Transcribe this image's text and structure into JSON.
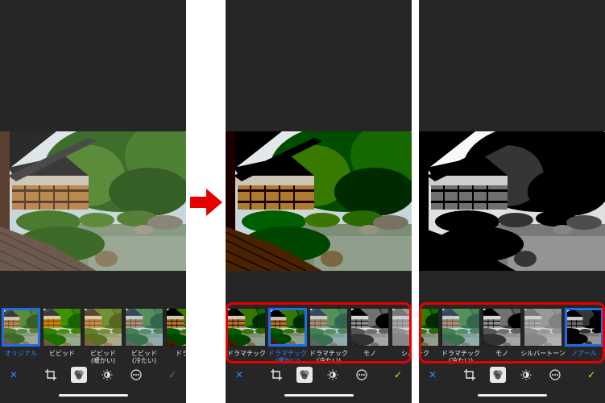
{
  "colors": {
    "accent": "#1f6ee8",
    "annotation": "#e60000",
    "done": "#ffd60a"
  },
  "panels": [
    {
      "filters": [
        "オリジナル",
        "ビビッド",
        "ビビッド\n(暖かい)",
        "ビビッド\n(冷たい)",
        "ドラマ"
      ],
      "selected_index": 0,
      "done_enabled": false
    },
    {
      "filters": [
        "ドラマチック",
        "ドラマチック\n(暖かい)",
        "ドラマチック\n(冷たい)",
        "モノ",
        "シルバ"
      ],
      "selected_index": 1,
      "done_enabled": true
    },
    {
      "filters": [
        "チック",
        "ドラマチック\n(冷たい)",
        "モノ",
        "シルバートーン",
        "ノアール"
      ],
      "selected_index": 4,
      "done_enabled": true
    }
  ],
  "toolbar_icons": [
    "close-icon",
    "crop-icon",
    "filters-icon",
    "adjust-icon",
    "more-icon",
    "checkmark-icon"
  ],
  "toolbar_glyphs": {
    "close": "✕",
    "more": "⋯",
    "done": "✓"
  },
  "annotations": {
    "arrow": "right-arrow",
    "highlight": "filter-strip"
  }
}
